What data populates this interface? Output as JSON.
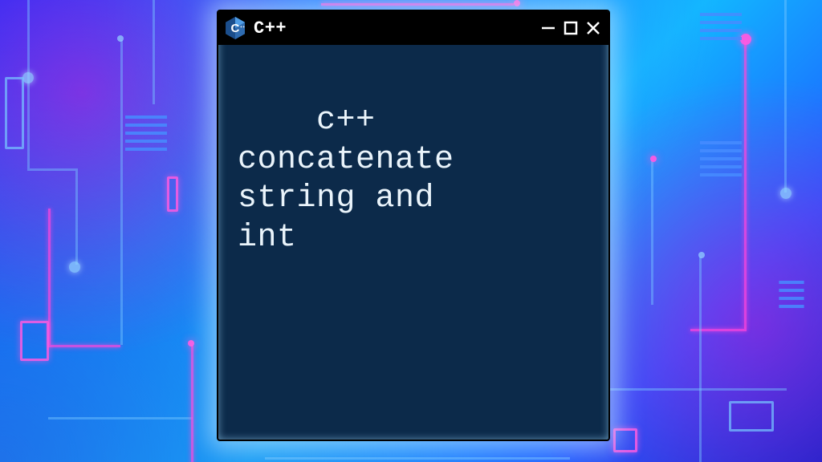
{
  "window": {
    "title": "C++",
    "logo_letter": "C",
    "controls": {
      "minimize": "minimize",
      "maximize": "maximize",
      "close": "close"
    }
  },
  "content": {
    "text": "c++\nconcatenate\nstring and\nint"
  }
}
